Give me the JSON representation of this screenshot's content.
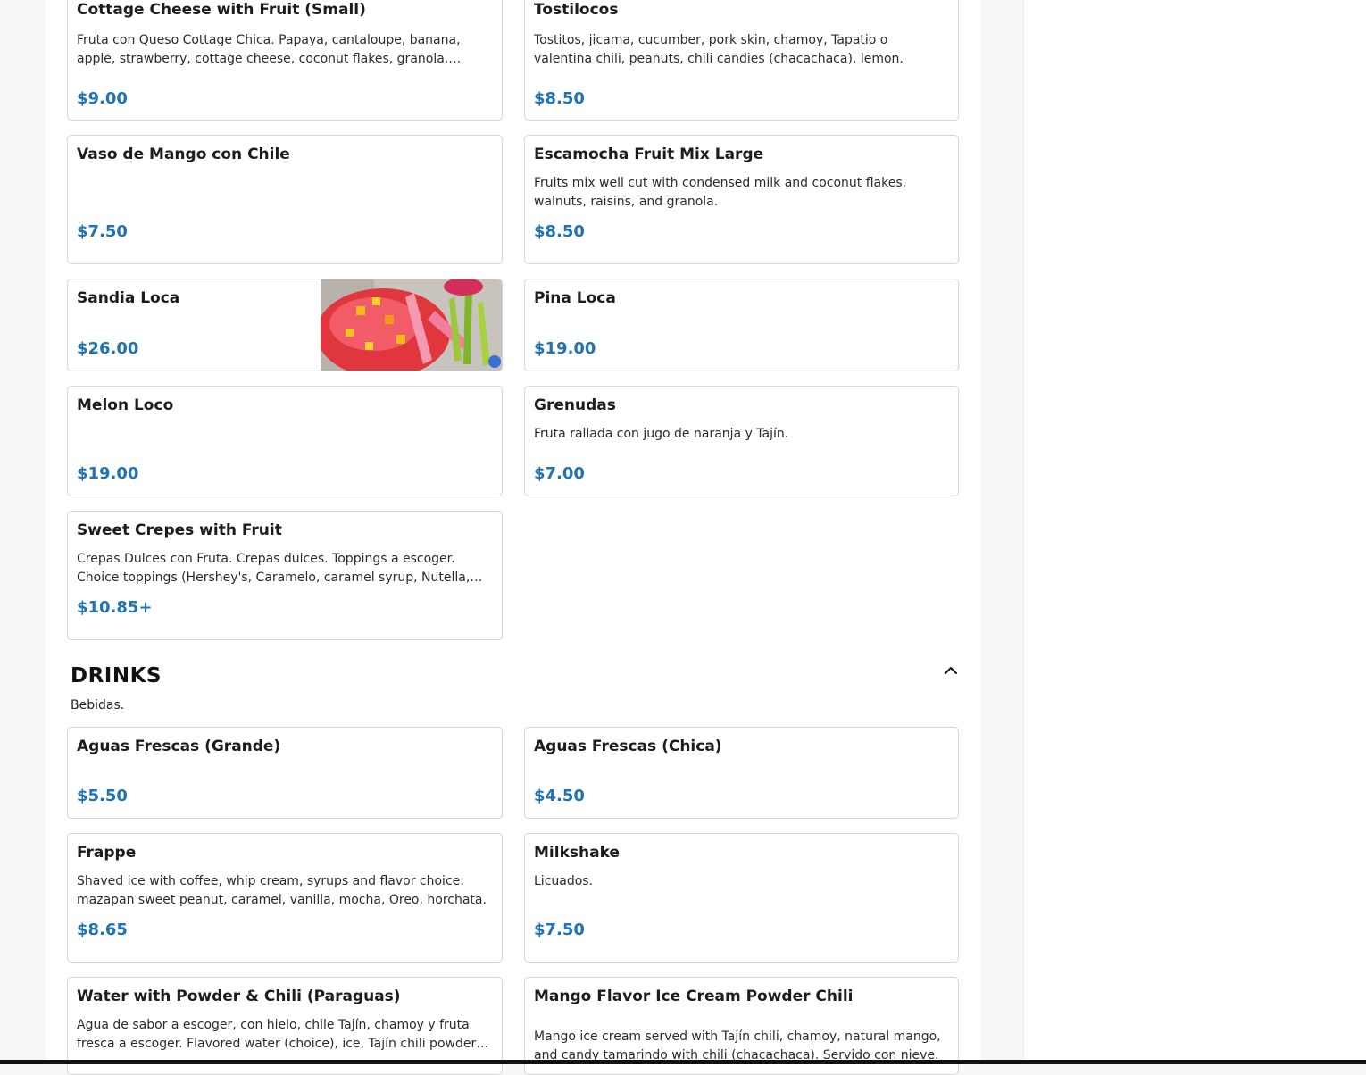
{
  "menu": {
    "fruit_items": [
      {
        "name": "Cottage Cheese with Fruit (Small)",
        "description": "Fruta con Queso Cottage Chica. Papaya, cantaloupe, banana, apple, strawberry, cottage cheese, coconut flakes, granola, raisins.",
        "price": "$9.00"
      },
      {
        "name": "Tostilocos",
        "description": "Tostitos, jicama, cucumber, pork skin, chamoy, Tapatio o valentina chili, peanuts, chili candies (chacachaca), lemon.",
        "price": "$8.50"
      },
      {
        "name": "Vaso de Mango con Chile",
        "description": "",
        "price": "$7.50"
      },
      {
        "name": "Escamocha Fruit Mix Large",
        "description": "Fruits mix well cut with condensed milk and coconut flakes, walnuts, raisins, and granola.",
        "price": "$8.50"
      },
      {
        "name": "Sandia Loca",
        "description": "",
        "price": "$26.00",
        "image": "watermelon-cup-image"
      },
      {
        "name": "Pina Loca",
        "description": "",
        "price": "$19.00"
      },
      {
        "name": "Melon Loco",
        "description": "",
        "price": "$19.00"
      },
      {
        "name": "Grenudas",
        "description": "Fruta rallada con jugo de naranja y Tajín.",
        "price": "$7.00"
      },
      {
        "name": "Sweet Crepes with Fruit",
        "description": "Crepas Dulces con Fruta. Crepas dulces. Toppings a escoger. Choice toppings (Hershey's, Caramelo, caramel syrup, Nutella, cajeta).",
        "price": "$10.85+"
      }
    ],
    "drinks_section": {
      "title": "DRINKS",
      "subtitle": "Bebidas.",
      "collapse_icon": "chevron-up-icon"
    },
    "drink_items": [
      {
        "name": "Aguas Frescas (Grande)",
        "description": "",
        "price": "$5.50"
      },
      {
        "name": "Aguas Frescas (Chica)",
        "description": "",
        "price": "$4.50"
      },
      {
        "name": "Frappe",
        "description": "Shaved ice with coffee, whip cream, syrups and flavor choice: mazapan sweet peanut, caramel, vanilla, mocha, Oreo, horchata.",
        "price": "$8.65"
      },
      {
        "name": "Milkshake",
        "description": "Licuados.",
        "price": "$7.50"
      },
      {
        "name": "Water with Powder & Chili (Paraguas)",
        "description": "Agua de sabor a escoger, con hielo, chile Tajín, chamoy y fruta fresca a escoger. Flavored water (choice), ice, Tajín chili powder, chamoy and fresh fruit.",
        "price": ""
      },
      {
        "name": "Mango Flavor Ice Cream Powder Chili (Chamango)",
        "description": "Mango ice cream served with Tajín chili, chamoy, natural mango, and candy tamarindo with chili (chacachaca). Servido con nieve.",
        "price": ""
      }
    ]
  },
  "colors": {
    "price": "#1f73b7",
    "card_border": "#d6d6d6",
    "page_bg": "#f7f7f7"
  }
}
